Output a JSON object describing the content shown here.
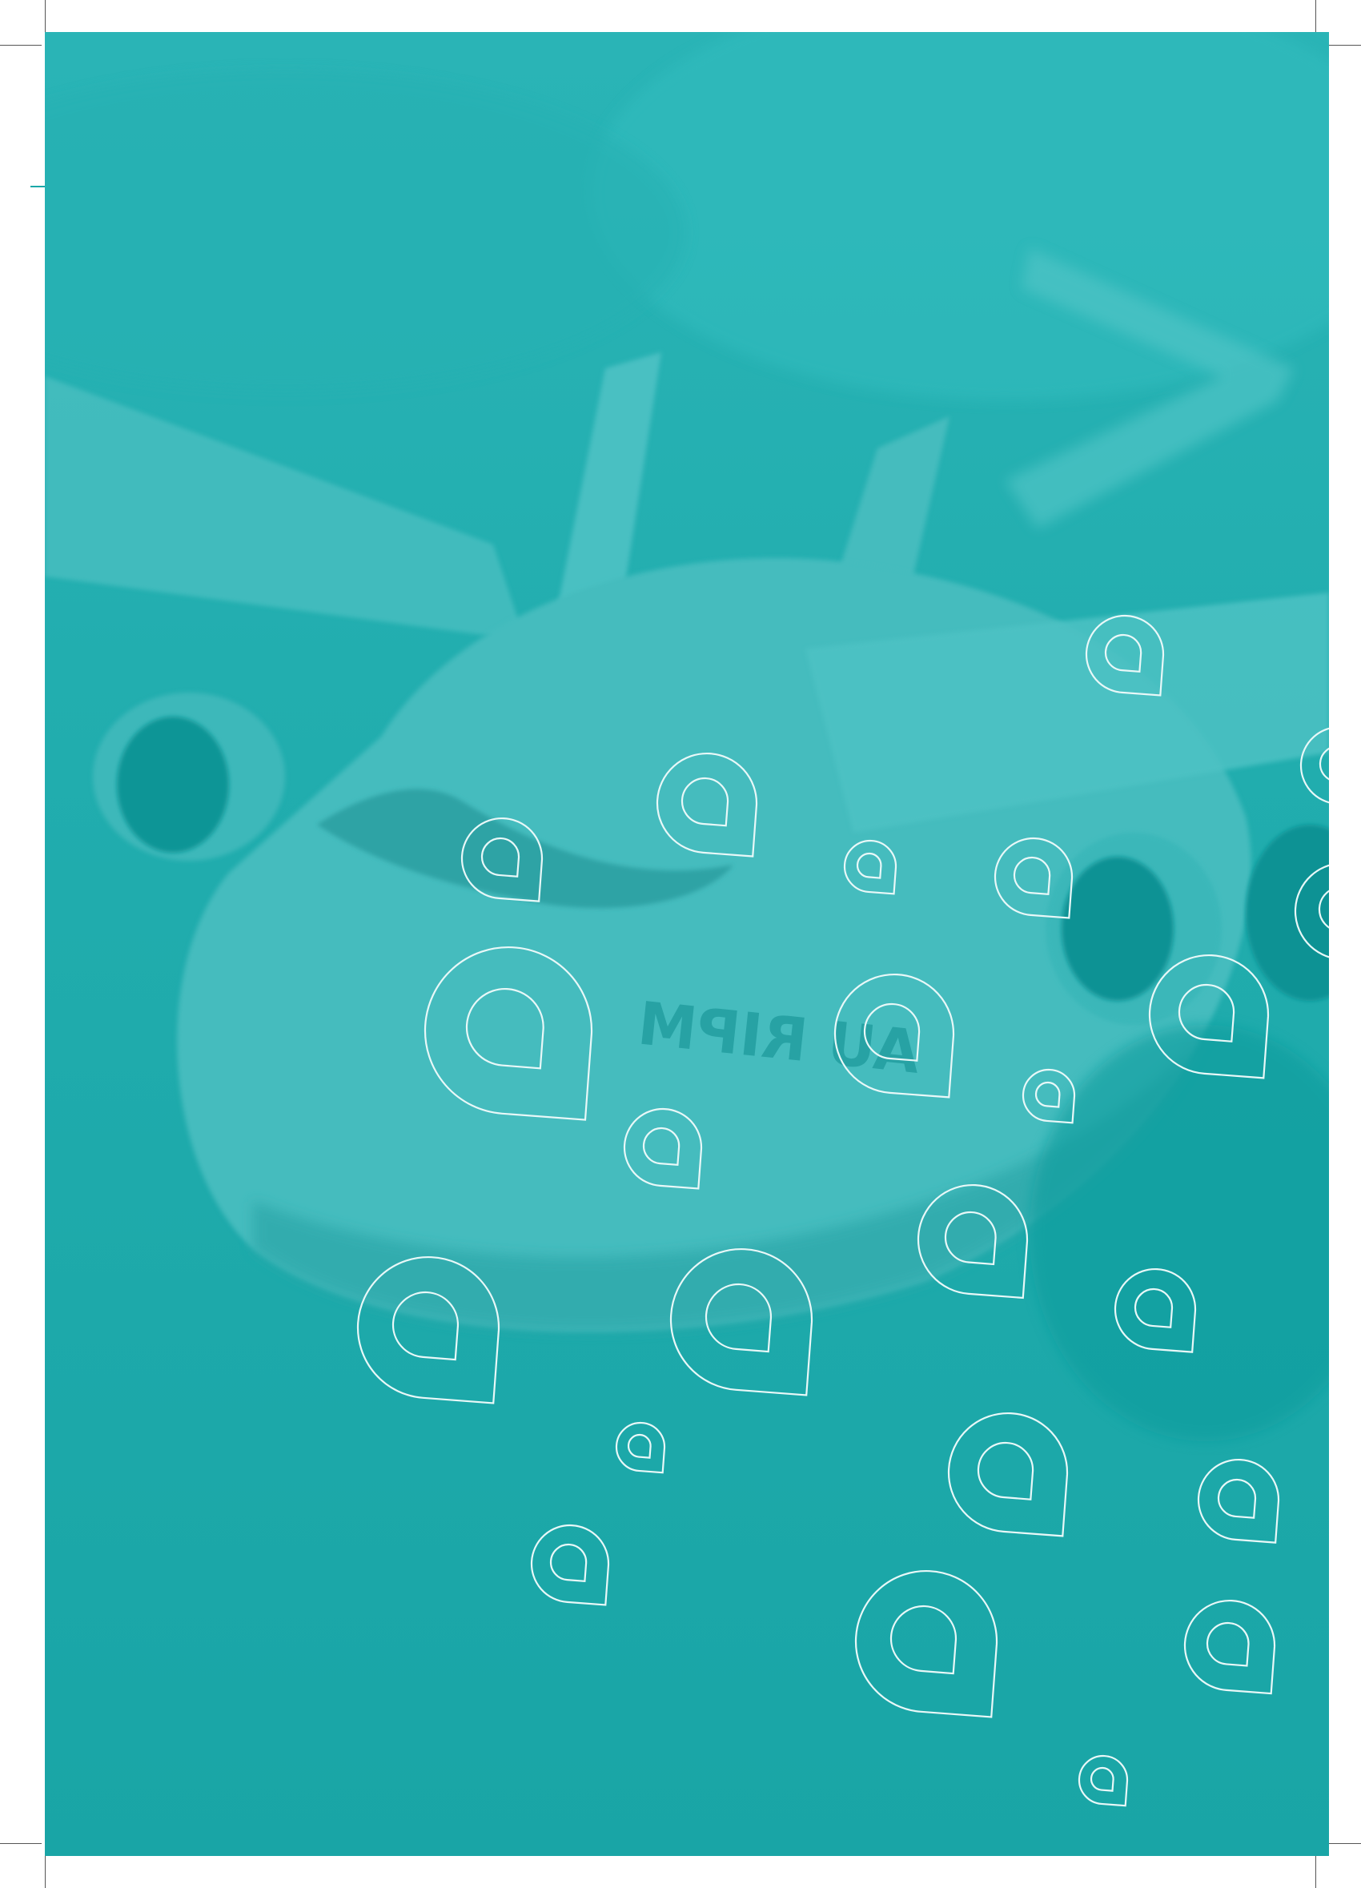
{
  "page": {
    "background_color": "#1fabac",
    "pin_stroke_color": "#e8f8f8"
  },
  "photo": {
    "subject": "toy-airplane",
    "printed_text": "AU RIPM"
  },
  "pins": {
    "icon": "map-pin-icon",
    "count": 26
  }
}
